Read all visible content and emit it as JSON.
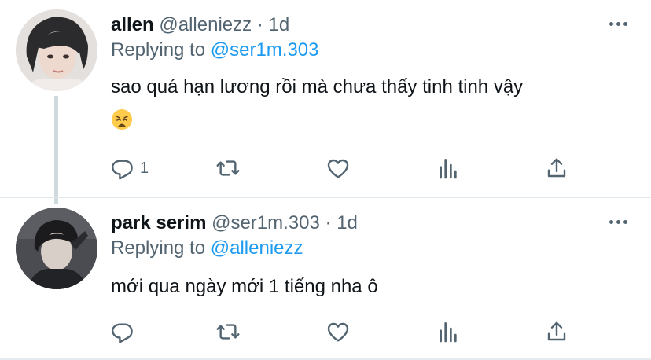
{
  "colors": {
    "accent": "#1d9bf0",
    "muted": "#536471",
    "text": "#0f1419",
    "thread_line": "#cfd9de"
  },
  "tweets": [
    {
      "name": "allen",
      "handle": "@alleniezz",
      "separator": "·",
      "time": "1d",
      "replying_prefix": "Replying to",
      "replying_to": "@ser1m.303",
      "text": "sao quá hạn lương rồi mà chưa thấy tinh tinh vậy",
      "emoji": "weary-face-emoji",
      "reply_count": "1",
      "icons": [
        "reply-icon",
        "retweet-icon",
        "like-icon",
        "stats-icon",
        "share-icon",
        "more-icon"
      ]
    },
    {
      "name": "park serim",
      "handle": "@ser1m.303",
      "separator": "·",
      "time": "1d",
      "replying_prefix": "Replying to",
      "replying_to": "@alleniezz",
      "text": "mới qua ngày mới 1 tiếng nha ô",
      "reply_count": "",
      "icons": [
        "reply-icon",
        "retweet-icon",
        "like-icon",
        "stats-icon",
        "share-icon",
        "more-icon"
      ]
    }
  ]
}
